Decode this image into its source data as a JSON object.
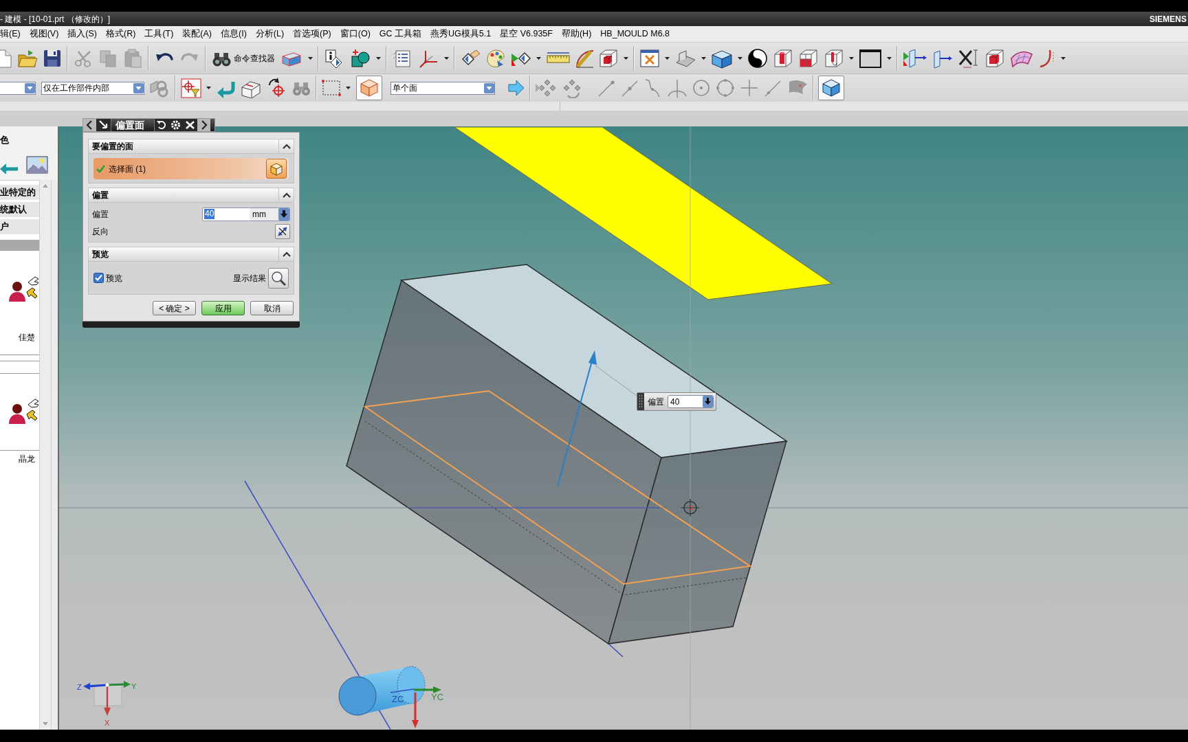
{
  "window": {
    "title": "- 建模 - [10-01.prt （修改的）]",
    "brand": "SIEMENS"
  },
  "menu_bar": [
    {
      "label": "辑(E)"
    },
    {
      "label": "视图(V)"
    },
    {
      "label": "插入(S)"
    },
    {
      "label": "格式(R)"
    },
    {
      "label": "工具(T)"
    },
    {
      "label": "装配(A)"
    },
    {
      "label": "信息(I)"
    },
    {
      "label": "分析(L)"
    },
    {
      "label": "首选项(P)"
    },
    {
      "label": "窗口(O)"
    },
    {
      "label": "GC 工具箱"
    },
    {
      "label": "燕秀UG模具5.1"
    },
    {
      "label": "星空 V6.935F"
    },
    {
      "label": "帮助(H)"
    },
    {
      "label": "HB_MOULD M6.8"
    }
  ],
  "toolbar": {
    "command_finder": "命令查找器"
  },
  "selection_bar": {
    "scope": "仅在工作部件内部",
    "face_rule": "单个面"
  },
  "left_panel": {
    "heading": "色",
    "categories": [
      {
        "label": "业特定的"
      },
      {
        "label": "统默认"
      },
      {
        "label": "户"
      }
    ],
    "roles": [
      {
        "label": "佳楚"
      },
      {
        "label": "晶龙"
      }
    ]
  },
  "dialog": {
    "title": "偏置面",
    "sections": [
      {
        "kind": "select",
        "title": "要偏置的面",
        "expanded": true,
        "label": "选择面 (1)",
        "done": true
      },
      {
        "kind": "offset",
        "title": "偏置",
        "expanded": true,
        "label": "偏置",
        "value": "40",
        "value_selected": true,
        "unit": "mm",
        "reverse_label": "反向"
      },
      {
        "kind": "preview",
        "title": "预览",
        "expanded": true,
        "label": "预览",
        "checked": true,
        "result_label": "显示结果"
      }
    ],
    "buttons": [
      {
        "label": "< 确定 >",
        "default": false
      },
      {
        "label": "应用",
        "default": true
      },
      {
        "label": "取消",
        "default": false
      }
    ]
  },
  "viewport": {
    "offset_handle": {
      "label": "偏置",
      "value": "40"
    },
    "wcs_labels": [
      "ZC",
      "YC"
    ],
    "triad_labels": [
      "Z",
      "Y",
      "X"
    ]
  }
}
